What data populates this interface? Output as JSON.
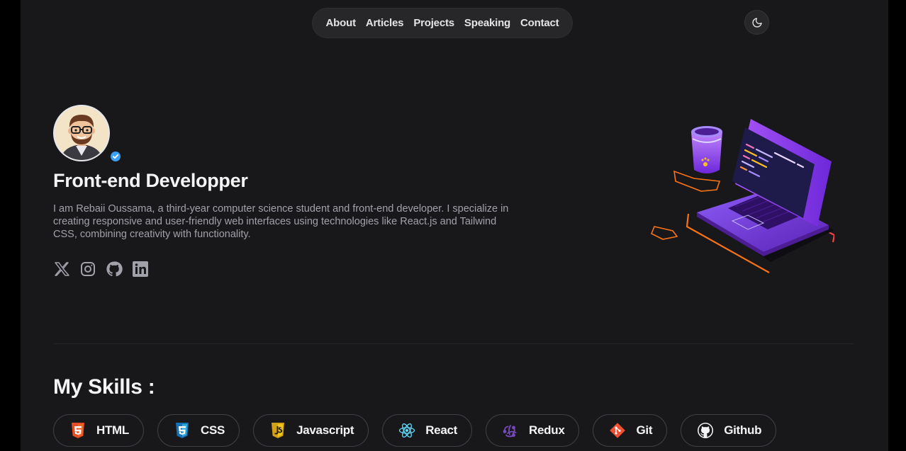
{
  "nav": {
    "items": [
      "About",
      "Articles",
      "Projects",
      "Speaking",
      "Contact"
    ]
  },
  "theme_toggle": {
    "icon": "moon-icon"
  },
  "hero": {
    "title": "Front-end Developper",
    "bio": "I am Rebaii Oussama, a third-year computer science student and front-end developer. I specialize in creating responsive and user-friendly web interfaces using technologies like React.js and Tailwind CSS, combining creativity with functionality.",
    "socials": [
      "x-icon",
      "instagram-icon",
      "github-icon",
      "linkedin-icon"
    ]
  },
  "skills": {
    "title": "My Skills :",
    "items": [
      {
        "label": "HTML",
        "icon": "html5-icon"
      },
      {
        "label": "CSS",
        "icon": "css3-icon"
      },
      {
        "label": "Javascript",
        "icon": "javascript-icon"
      },
      {
        "label": "React",
        "icon": "react-icon"
      },
      {
        "label": "Redux",
        "icon": "redux-icon"
      },
      {
        "label": "Git",
        "icon": "git-icon"
      },
      {
        "label": "Github",
        "icon": "github-icon"
      }
    ]
  },
  "colors": {
    "page_bg": "#18181b",
    "outer_bg": "#000000",
    "verified": "#3b9ff6",
    "accent_purple": "#7c3aed",
    "accent_orange": "#f97316"
  }
}
